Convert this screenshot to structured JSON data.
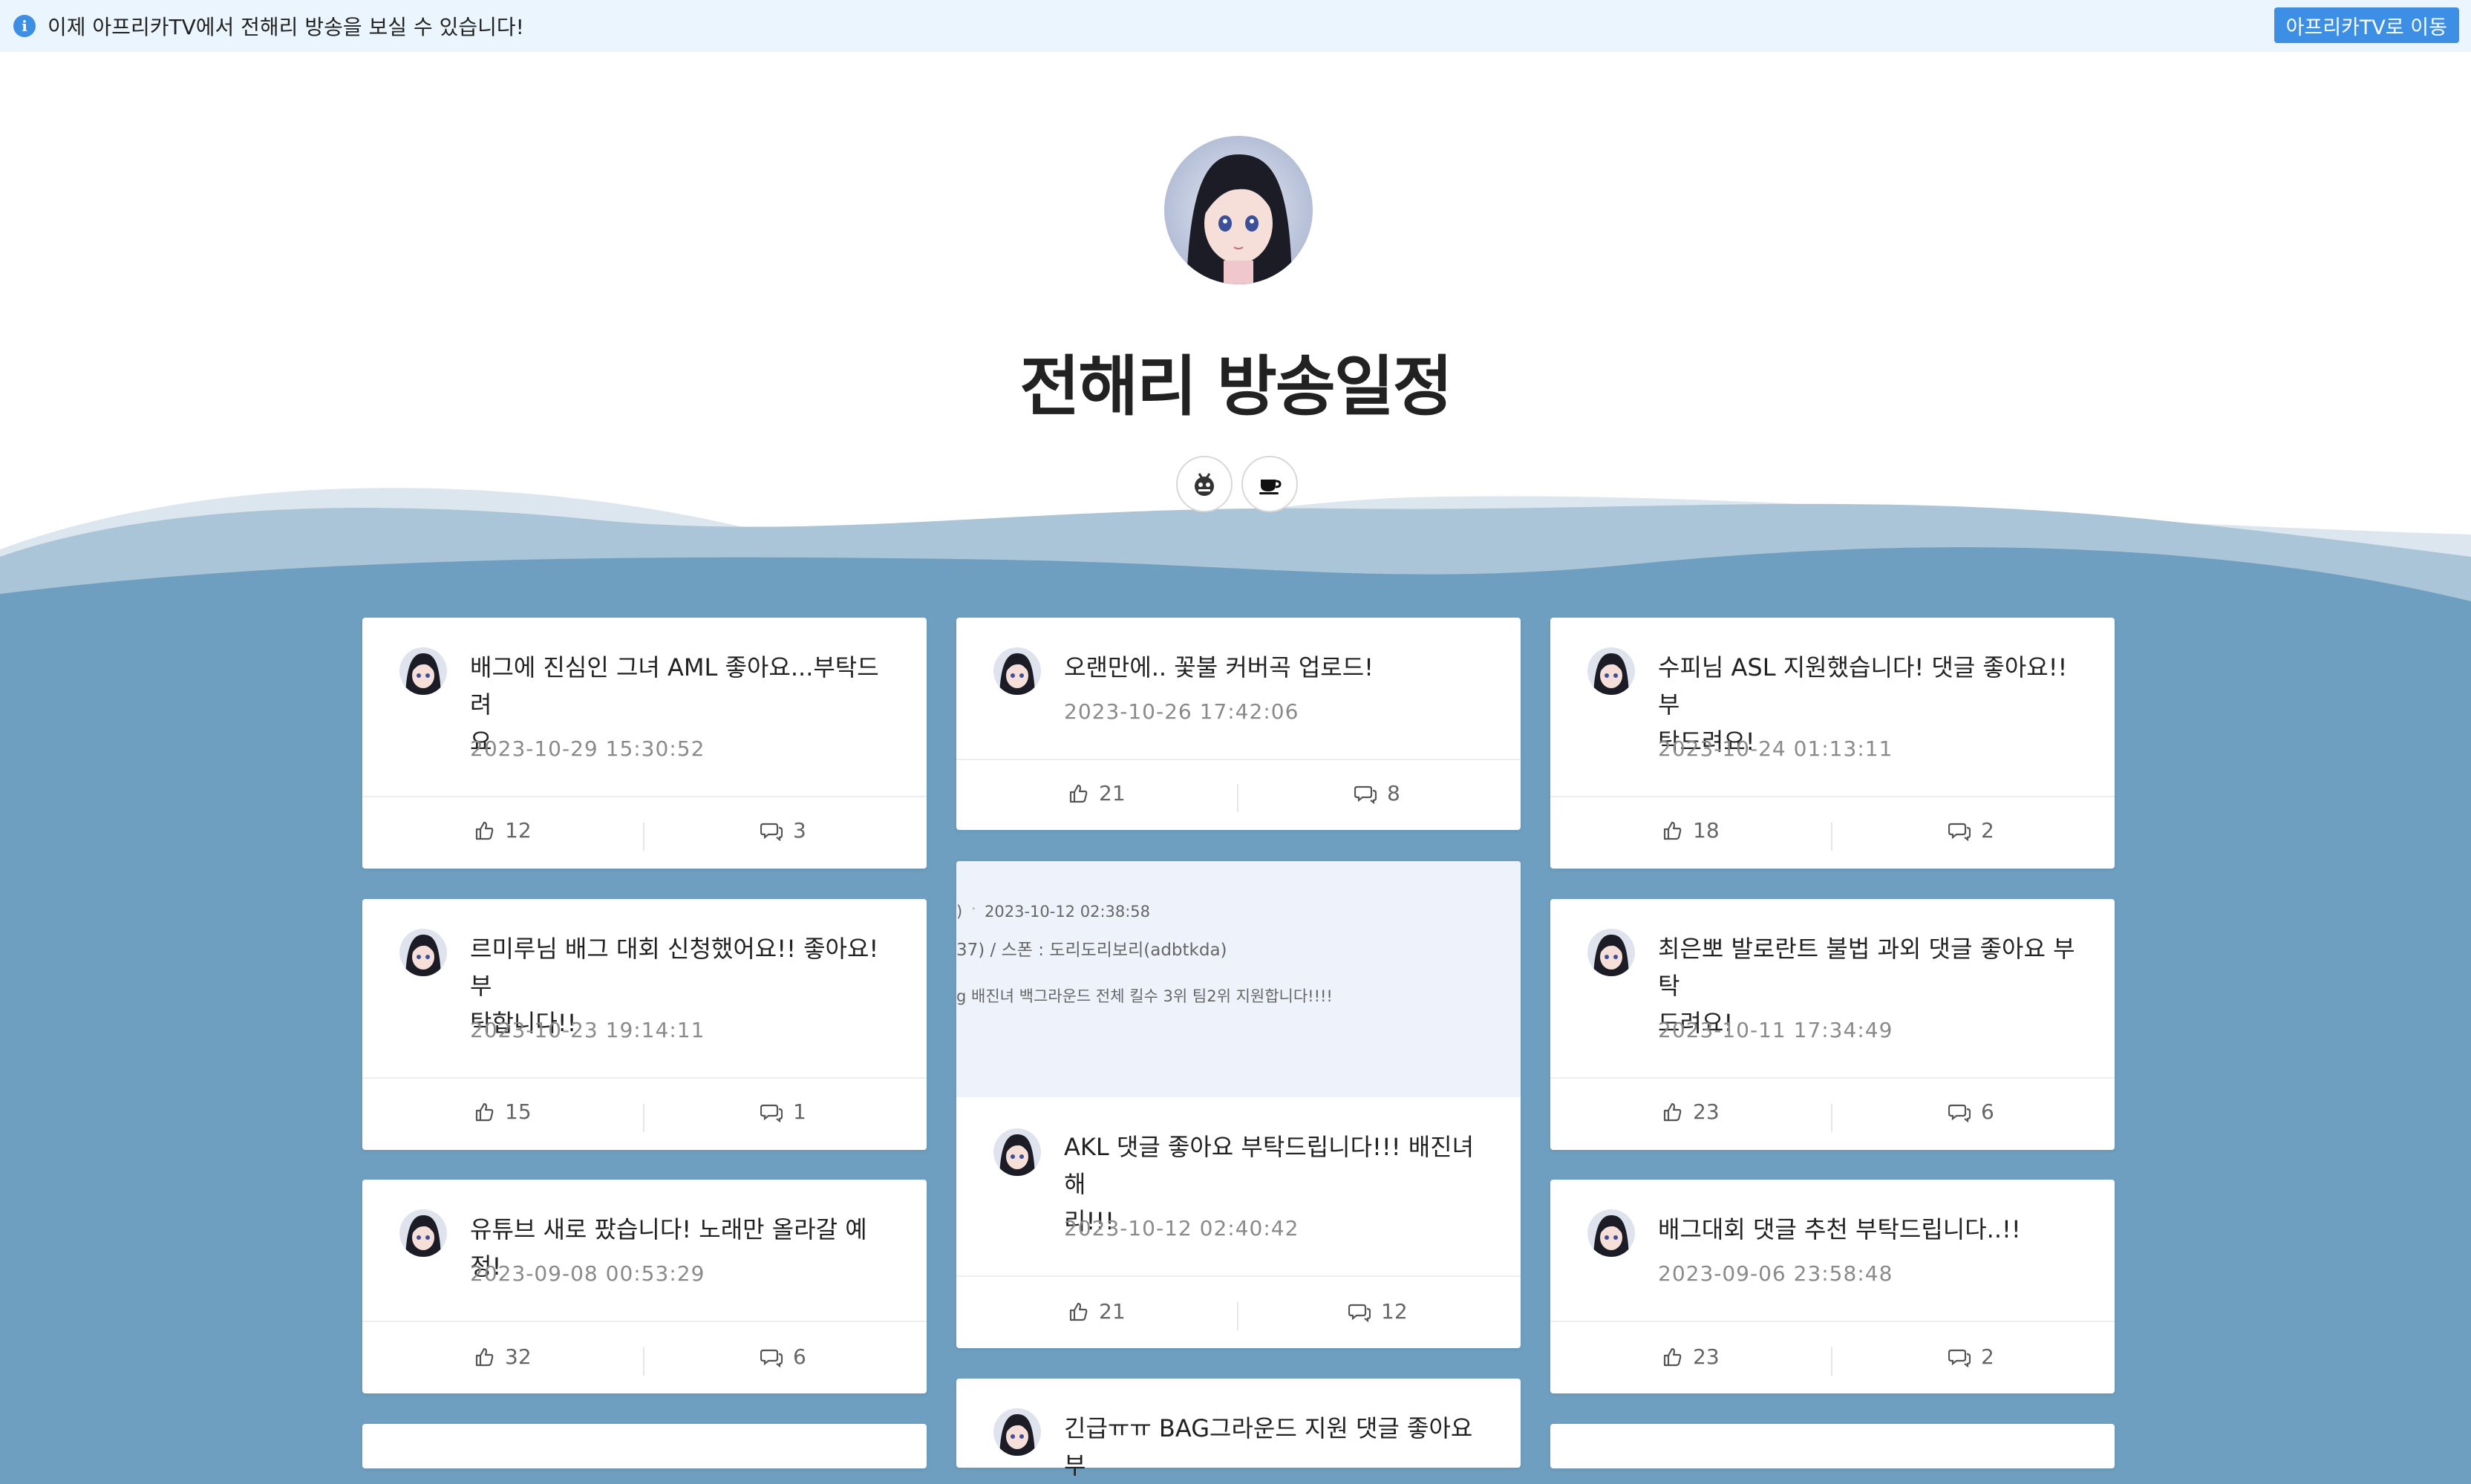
{
  "notice": {
    "text": "이제 아프리카TV에서 전해리 방송을 보실 수 있습니다!",
    "button": "아프리카TV로 이동"
  },
  "profile": {
    "title": "전해리 방송일정",
    "link_icons": [
      "afreecatv-icon",
      "coffee-cup-icon"
    ]
  },
  "colors": {
    "background": "#6f9fc0",
    "accent": "#3d8fe6",
    "notice_bg": "#eaf5fd"
  },
  "posts": [
    {
      "title_l1": "배그에 진심인 그녀 AML 좋아요...부탁드려",
      "title_l2": "요",
      "date": "2023-10-29 15:30:52",
      "likes": "12",
      "comments": "3"
    },
    {
      "title_l1": "오랜만에.. 꽃불 커버곡 업로드!",
      "title_l2": "",
      "date": "2023-10-26 17:42:06",
      "likes": "21",
      "comments": "8"
    },
    {
      "title_l1": "수피님 ASL 지원했습니다! 댓글 좋아요!! 부",
      "title_l2": "탁드려요!",
      "date": "2023-10-24 01:13:11",
      "likes": "18",
      "comments": "2"
    },
    {
      "title_l1": "르미루님 배그 대회 신청했어요!! 좋아요! 부",
      "title_l2": "탁합니다!!",
      "date": "2023-10-23 19:14:11",
      "likes": "15",
      "comments": "1"
    },
    {
      "title_l1": "AKL 댓글 좋아요 부탁드립니다!!! 배진녀 해",
      "title_l2": "리!!!",
      "date": "2023-10-12 02:40:42",
      "likes": "21",
      "comments": "12",
      "preview": {
        "line1_a": ")",
        "line1_b": "2023-10-12 02:38:58",
        "line2": "37) / 스폰 : 도리도리보리(adbtkda)",
        "line3": "g 배진녀 백그라운드 전체 킬수 3위 팀2위 지원합니다!!!!"
      }
    },
    {
      "title_l1": "최은뽀 발로란트 불법 과외 댓글 좋아요 부탁",
      "title_l2": "드려요!",
      "date": "2023-10-11 17:34:49",
      "likes": "23",
      "comments": "6"
    },
    {
      "title_l1": "유튜브 새로 팠습니다! 노래만 올라갈 예정!",
      "title_l2": "",
      "date": "2023-09-08 00:53:29",
      "likes": "32",
      "comments": "6"
    },
    {
      "title_l1": "배그대회 댓글 추천 부탁드립니다..!!",
      "title_l2": "",
      "date": "2023-09-06 23:58:48",
      "likes": "23",
      "comments": "2"
    },
    {
      "title_l1": "긴급ㅠㅠ BAG그라운드 지원 댓글 좋아요 부",
      "title_l2": ""
    }
  ]
}
